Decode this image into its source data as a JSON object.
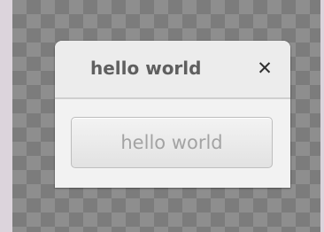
{
  "window": {
    "title": "hello world"
  },
  "titlebar": {
    "close_icon": "✕"
  },
  "main": {
    "button_label": "hello world"
  },
  "colors": {
    "background": "#dcd4dc",
    "dialog": "#f2f2f2",
    "title_text": "#5f5f5f",
    "button_text": "#a3a3a3"
  }
}
